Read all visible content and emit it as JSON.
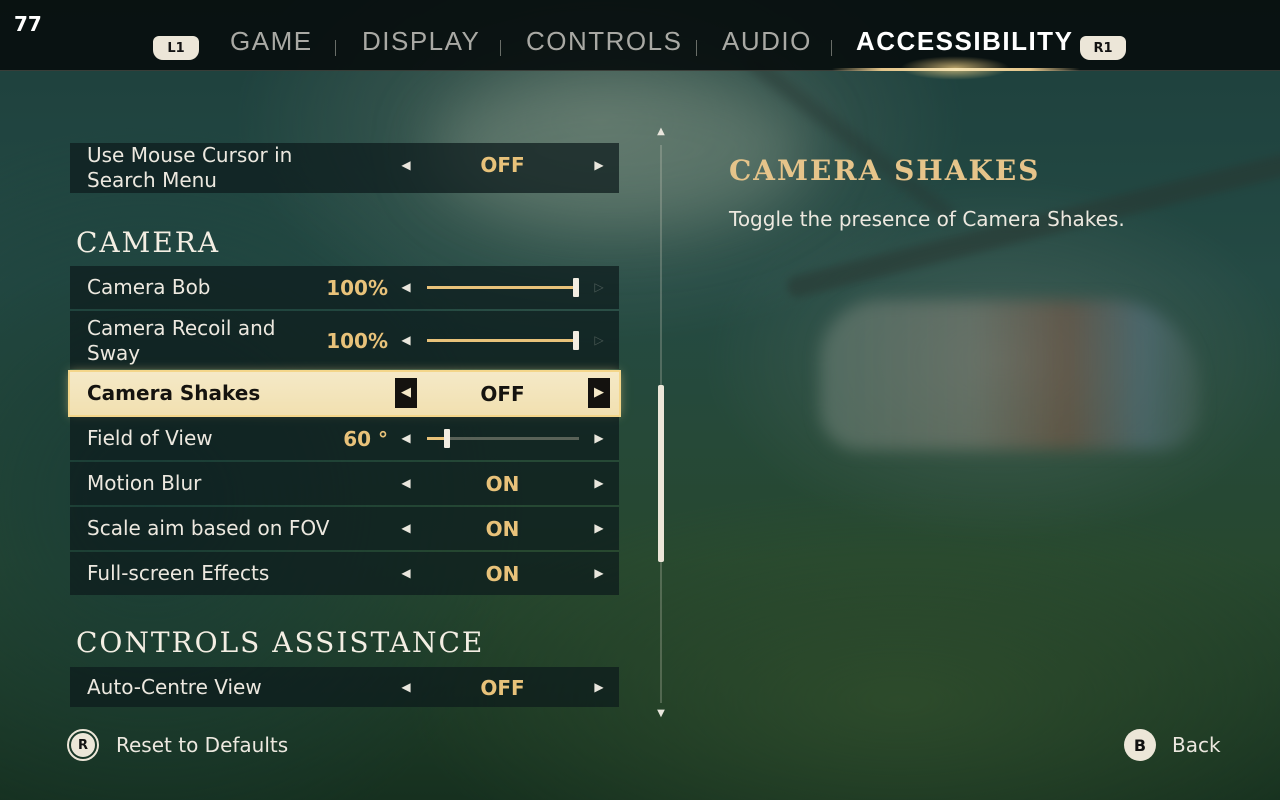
{
  "hud": {
    "fps": "77"
  },
  "nav": {
    "left_shoulder": "L1",
    "right_shoulder": "R1",
    "tabs": [
      {
        "label": "GAME",
        "active": false
      },
      {
        "label": "DISPLAY",
        "active": false
      },
      {
        "label": "CONTROLS",
        "active": false
      },
      {
        "label": "AUDIO",
        "active": false
      },
      {
        "label": "ACCESSIBILITY",
        "active": true
      }
    ]
  },
  "settings": {
    "search_cursor": {
      "label": "Use Mouse Cursor in Search Menu",
      "value": "OFF"
    },
    "camera_section": "CAMERA",
    "camera_bob": {
      "label": "Camera Bob",
      "value": "100%",
      "level": 1.0
    },
    "camera_recoil": {
      "label": "Camera Recoil and Sway",
      "value": "100%",
      "level": 1.0
    },
    "camera_shakes": {
      "label": "Camera Shakes",
      "value": "OFF",
      "selected": true
    },
    "field_of_view": {
      "label": "Field of View",
      "value": "60 °",
      "level": 0.15
    },
    "motion_blur": {
      "label": "Motion Blur",
      "value": "ON"
    },
    "scale_aim": {
      "label": "Scale aim based on FOV",
      "value": "ON"
    },
    "fullscreen_effects": {
      "label": "Full-screen Effects",
      "value": "ON"
    },
    "controls_section": "CONTROLS ASSISTANCE",
    "auto_centre": {
      "label": "Auto-Centre View",
      "value": "OFF"
    }
  },
  "description": {
    "title": "CAMERA SHAKES",
    "text": "Toggle the presence of Camera Shakes."
  },
  "footer": {
    "reset_key": "R",
    "reset_label": "Reset to Defaults",
    "back_key": "B",
    "back_label": "Back"
  },
  "colors": {
    "accent": "#e8c27a",
    "selected_bg": "#f5e9c7",
    "row_bg": "#0c1a1c"
  }
}
